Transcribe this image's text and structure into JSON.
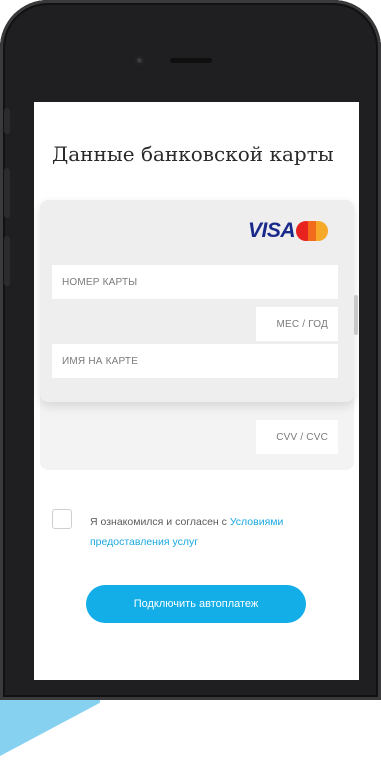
{
  "form": {
    "title": "Данные банковской карты",
    "card_number_placeholder": "НОМЕР КАРТЫ",
    "expiry_placeholder": "МЕС / ГОД",
    "holder_placeholder": "ИМЯ НА КАРТЕ",
    "cvv_placeholder": "CVV / CVC",
    "brands": {
      "visa": "VISA",
      "mastercard_icon": "mastercard-icon"
    }
  },
  "agreement": {
    "text": "Я ознакомился и согласен с ",
    "link": "Условиями предоставления услуг",
    "checked": false
  },
  "cta": {
    "label": "Подключить автоплатеж"
  },
  "colors": {
    "accent": "#13aee8",
    "link": "#1aa8e0",
    "visa": "#1a2a8a",
    "background_shape": "#86d0f0"
  }
}
